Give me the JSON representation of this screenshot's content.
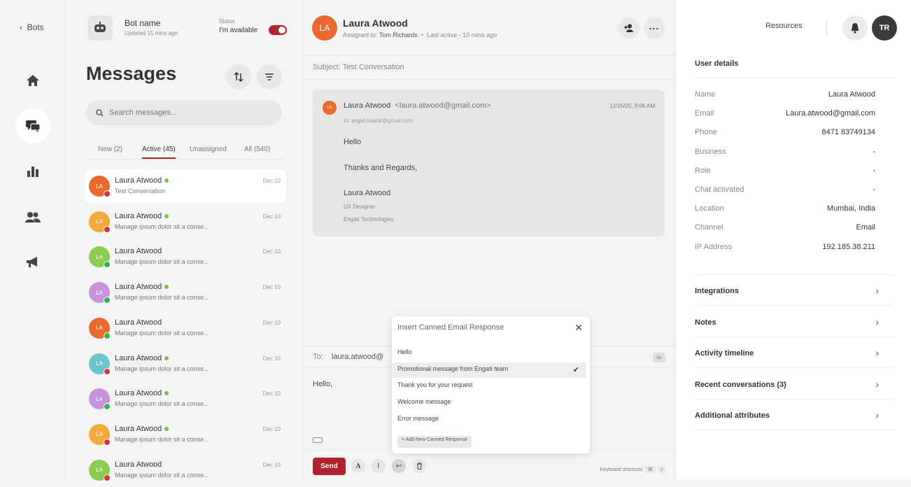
{
  "nav": {
    "back_label": "Bots"
  },
  "bot": {
    "name": "Bot name",
    "updated": "Updated 15 mins ago",
    "status_label": "Status",
    "status_value": "I'm available"
  },
  "messages": {
    "title": "Messages",
    "search_placeholder": "Search messages...",
    "tabs": [
      "New (2)",
      "Active (45)",
      "Unassigned",
      "All (540)"
    ],
    "conversations": [
      {
        "initials": "LA",
        "name": "Laura Atwood",
        "preview": "Test Conversation",
        "date": "Dec 10",
        "online": true,
        "avatar_color": "#e96a2c",
        "channel_color": "#d0343f"
      },
      {
        "initials": "LA",
        "name": "Laura Atwood",
        "preview": "Manage ipsum dolor sit a conse...",
        "date": "Dec 10",
        "online": true,
        "avatar_color": "#f0a93a",
        "channel_color": "#d0343f"
      },
      {
        "initials": "LA",
        "name": "Laura Atwood",
        "preview": "Manage ipsum dolor sit a conse...",
        "date": "Dec 10",
        "online": false,
        "avatar_color": "#8ccc52",
        "channel_color": "#34b34a"
      },
      {
        "initials": "LA",
        "name": "Laura Atwood",
        "preview": "Manage ipsum dolor sit a conse...",
        "date": "Dec 10",
        "online": true,
        "avatar_color": "#c993db",
        "channel_color": "#34b34a"
      },
      {
        "initials": "LA",
        "name": "Laura Atwood",
        "preview": "Manage ipsum dolor sit a conse...",
        "date": "Dec 10",
        "online": false,
        "avatar_color": "#e96a2c",
        "channel_color": "#34b34a"
      },
      {
        "initials": "LA",
        "name": "Laura Atwood",
        "preview": "Manage ipsum dolor sit a conse...",
        "date": "Dec 10",
        "online": true,
        "avatar_color": "#6fc3cf",
        "channel_color": "#d0343f"
      },
      {
        "initials": "LA",
        "name": "Laura Atwood",
        "preview": "Manage ipsum dolor sit a conse...",
        "date": "Dec 10",
        "online": true,
        "avatar_color": "#c993db",
        "channel_color": "#34b34a"
      },
      {
        "initials": "LA",
        "name": "Laura Atwood",
        "preview": "Manage ipsum dolor sit a conse...",
        "date": "Dec 10",
        "online": true,
        "avatar_color": "#f0a93a",
        "channel_color": "#d0343f"
      },
      {
        "initials": "LA",
        "name": "Laura Atwood",
        "preview": "Manage ipsum dolor sit a conse...",
        "date": "Dec 10",
        "online": false,
        "avatar_color": "#8ccc52",
        "channel_color": "#d0343f"
      }
    ]
  },
  "chat": {
    "initials": "LA",
    "name": "Laura Atwood",
    "assigned_prefix": "Assigned to:",
    "assigned_to": "Tom Richards",
    "last_active": "Last active - 10 mins ago",
    "subject_label": "Subject:",
    "subject": "Test Conversation",
    "email": {
      "initials": "LA",
      "from_name": "Laura Atwood",
      "from_addr": "<laura.atwood@gmail.com>",
      "date": "12/15/20, 9:06 AM",
      "to": "to: angel.baank@gmail.com",
      "greeting": "Hello",
      "closing": "Thanks and Regards,",
      "sig_name": "Laura Atwood",
      "sig_title": "UX Designer",
      "sig_company": "Engati Technologies"
    },
    "compose": {
      "to_label": "To:",
      "to_value": "laura.atwood@",
      "cc": "cc",
      "body": "Hello,"
    },
    "send_label": "Send",
    "keyboard_shortcuts": "Keyboard shortcuts",
    "kbd_keys": [
      "⌘",
      "/"
    ]
  },
  "canned": {
    "title": "Insert Canned Email Response",
    "items": [
      "Hello",
      "Promotional message from Engati team",
      "Thank you for your request",
      "Welcome message",
      "Error message"
    ],
    "selected_index": 1,
    "add_label": "+ Add New Canned Response"
  },
  "right": {
    "resources": "Resources",
    "user_initials": "TR",
    "user_details_title": "User details",
    "details": [
      {
        "k": "Name",
        "v": "Laura Atwood"
      },
      {
        "k": "Email",
        "v": "Laura.atwood@gmail.com"
      },
      {
        "k": "Phone",
        "v": "8471 83749134"
      },
      {
        "k": "Business",
        "v": "-"
      },
      {
        "k": "Role",
        "v": "-"
      },
      {
        "k": "Chat activated",
        "v": "-"
      },
      {
        "k": "Location",
        "v": "Mumbai, India"
      },
      {
        "k": "Channel",
        "v": "Email"
      },
      {
        "k": "IP Address",
        "v": "192.185.38.211"
      }
    ],
    "sections": [
      "Integrations",
      "Notes",
      "Activity timeline",
      "Recent conversations (3)",
      "Additional attributes"
    ]
  },
  "colors": {
    "brand": "#b0232e",
    "online": "#7ac142"
  }
}
